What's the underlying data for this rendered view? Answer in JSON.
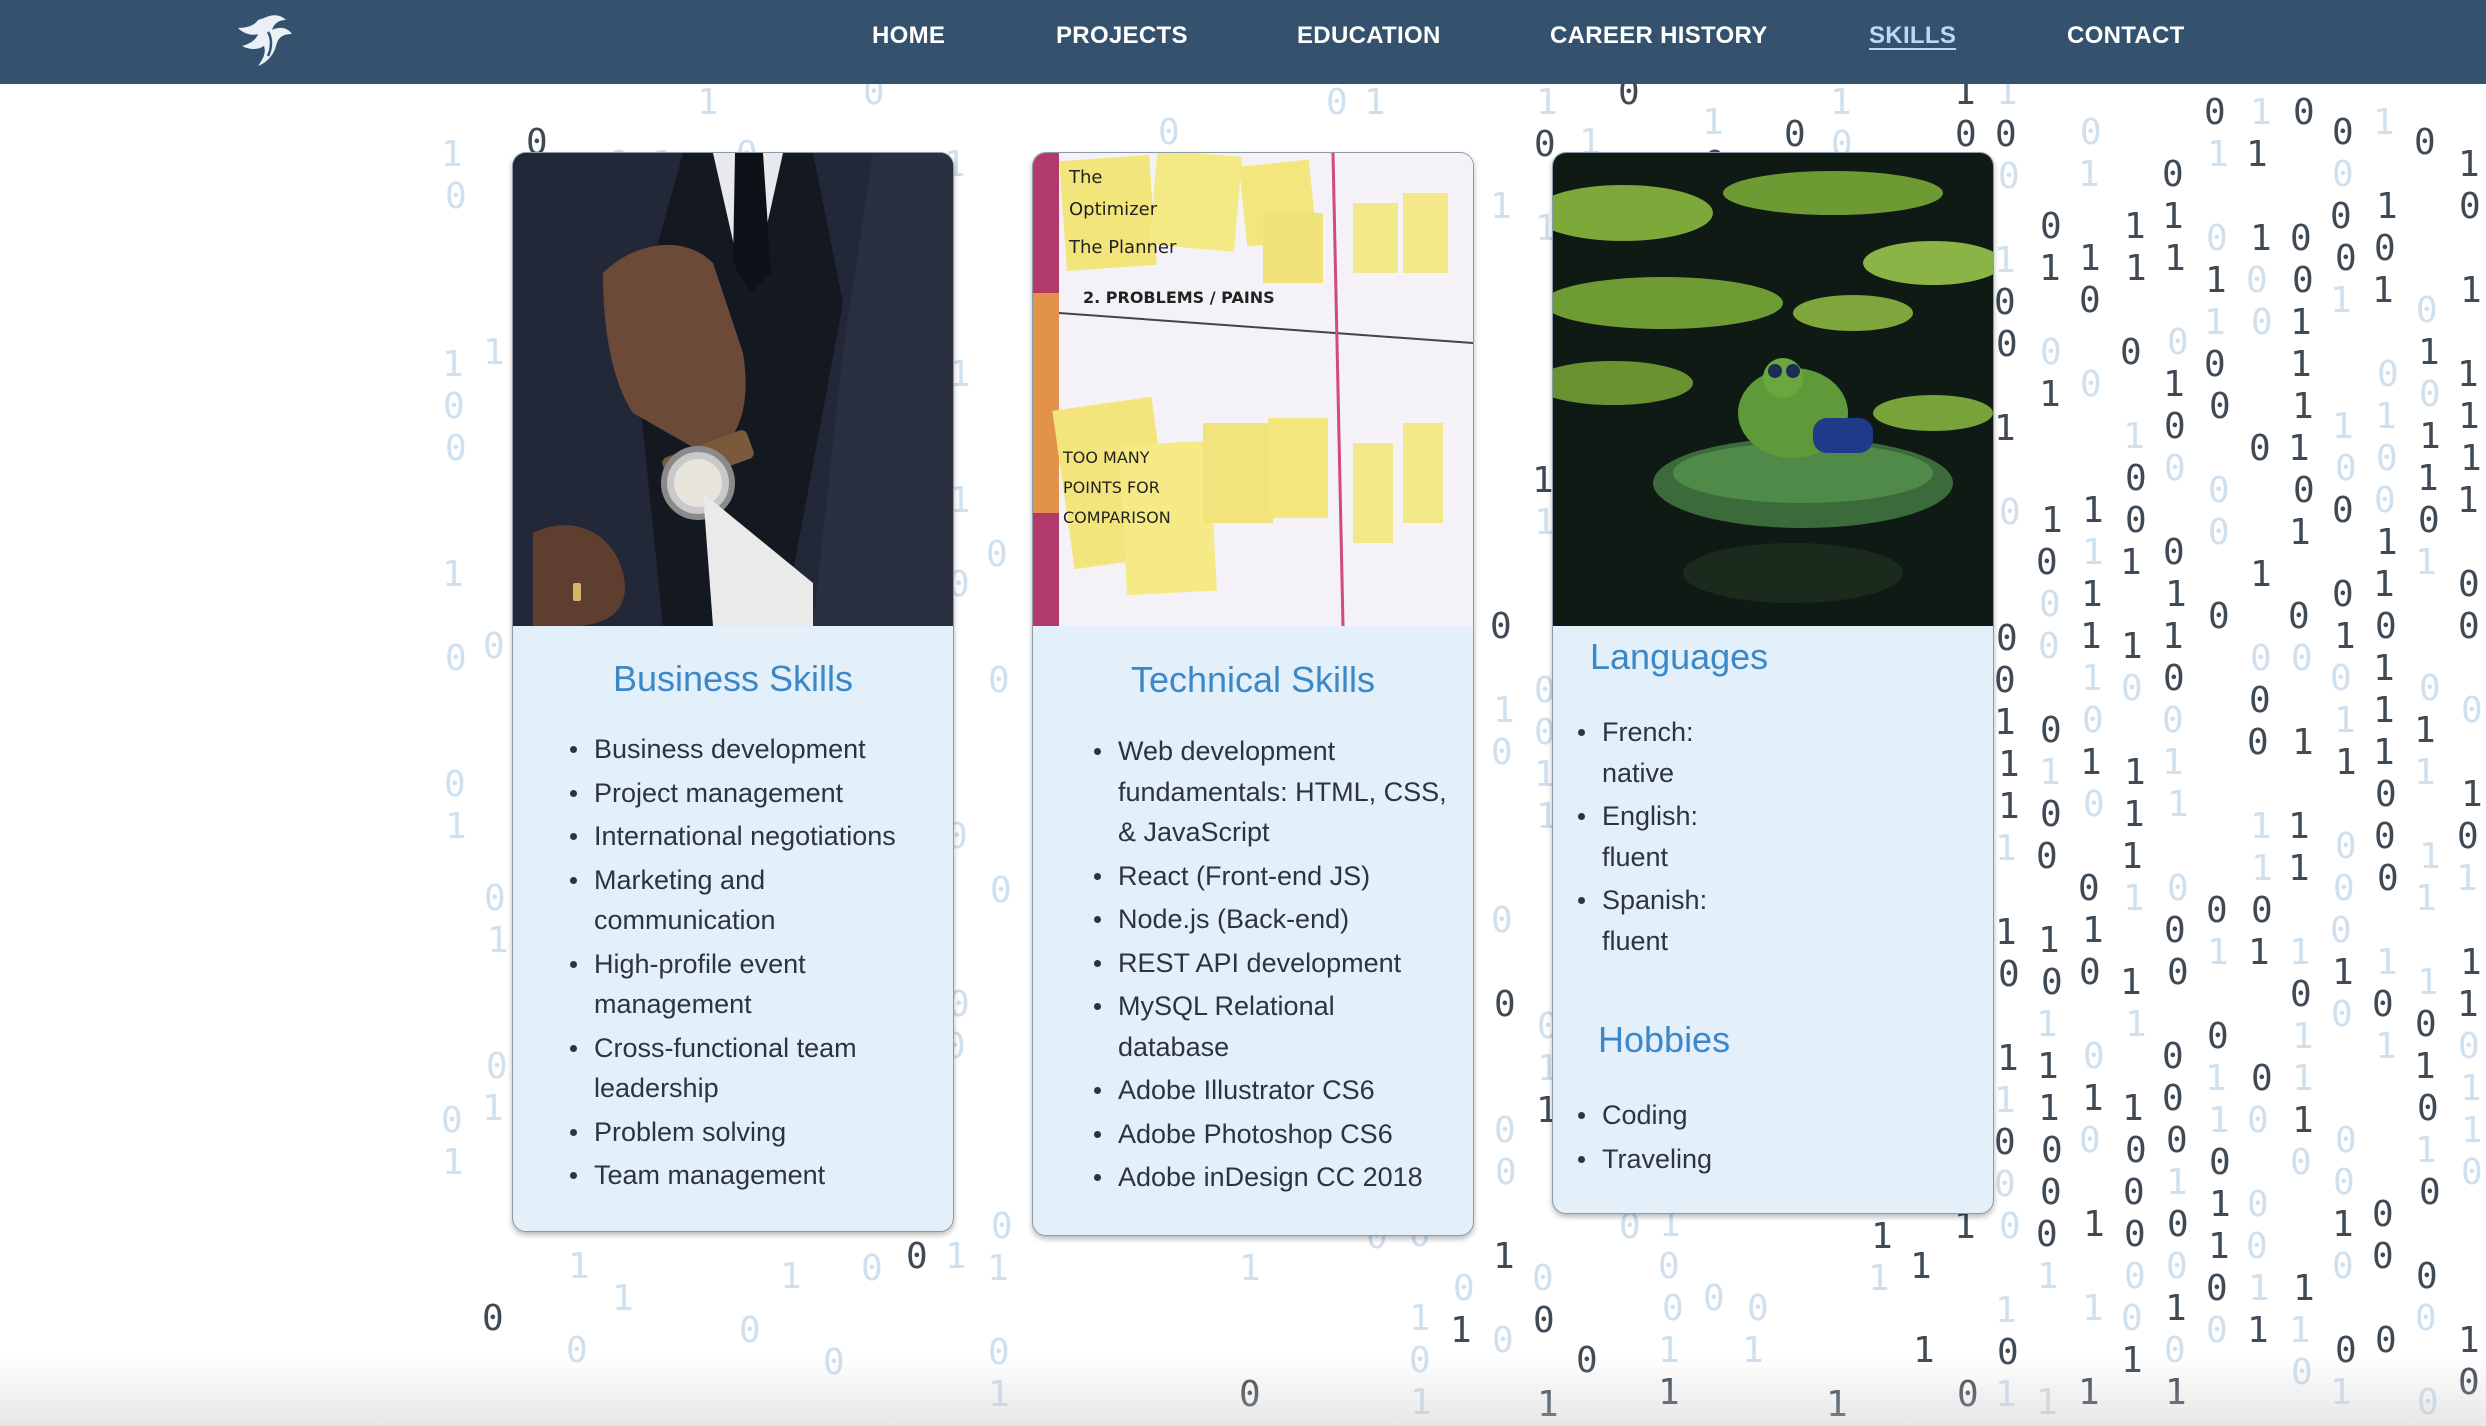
{
  "nav": {
    "links": [
      "HOME",
      "PROJECTS",
      "EDUCATION",
      "CAREER HISTORY",
      "SKILLS",
      "CONTACT"
    ],
    "active": "SKILLS"
  },
  "cards": {
    "business": {
      "title": "Business Skills",
      "items": [
        "Business development",
        "Project management",
        "International negotiations",
        "Marketing and communication",
        "High-profile event management",
        "Cross-functional team leadership",
        "Problem solving",
        "Team management"
      ]
    },
    "technical": {
      "title": "Technical Skills",
      "items": [
        "Web development fundamentals: HTML, CSS, & JavaScript",
        "React (Front-end JS)",
        "Node.js (Back-end)",
        "REST API development",
        "MySQL Relational database",
        "Adobe Illustrator CS6",
        "Adobe Photoshop CS6",
        "Adobe inDesign CC 2018"
      ]
    },
    "languages": {
      "title": "Languages",
      "items": [
        "French: native",
        "English: fluent",
        "Spanish: fluent"
      ]
    },
    "hobbies": {
      "title": "Hobbies",
      "items": [
        "Coding",
        "Traveling"
      ]
    }
  },
  "images": {
    "business": "man-in-suit-adjusting-tie-photo",
    "technical": "whiteboard-with-sticky-notes-photo",
    "languages": "frog-figurine-on-lily-pad-photo"
  },
  "background": "binary-digit-rain",
  "colors": {
    "navbar": "#34526e",
    "card_background": "#e4f0f9",
    "heading": "#3a87c9",
    "text": "#2c3440",
    "active_link": "#bcd6ff"
  }
}
